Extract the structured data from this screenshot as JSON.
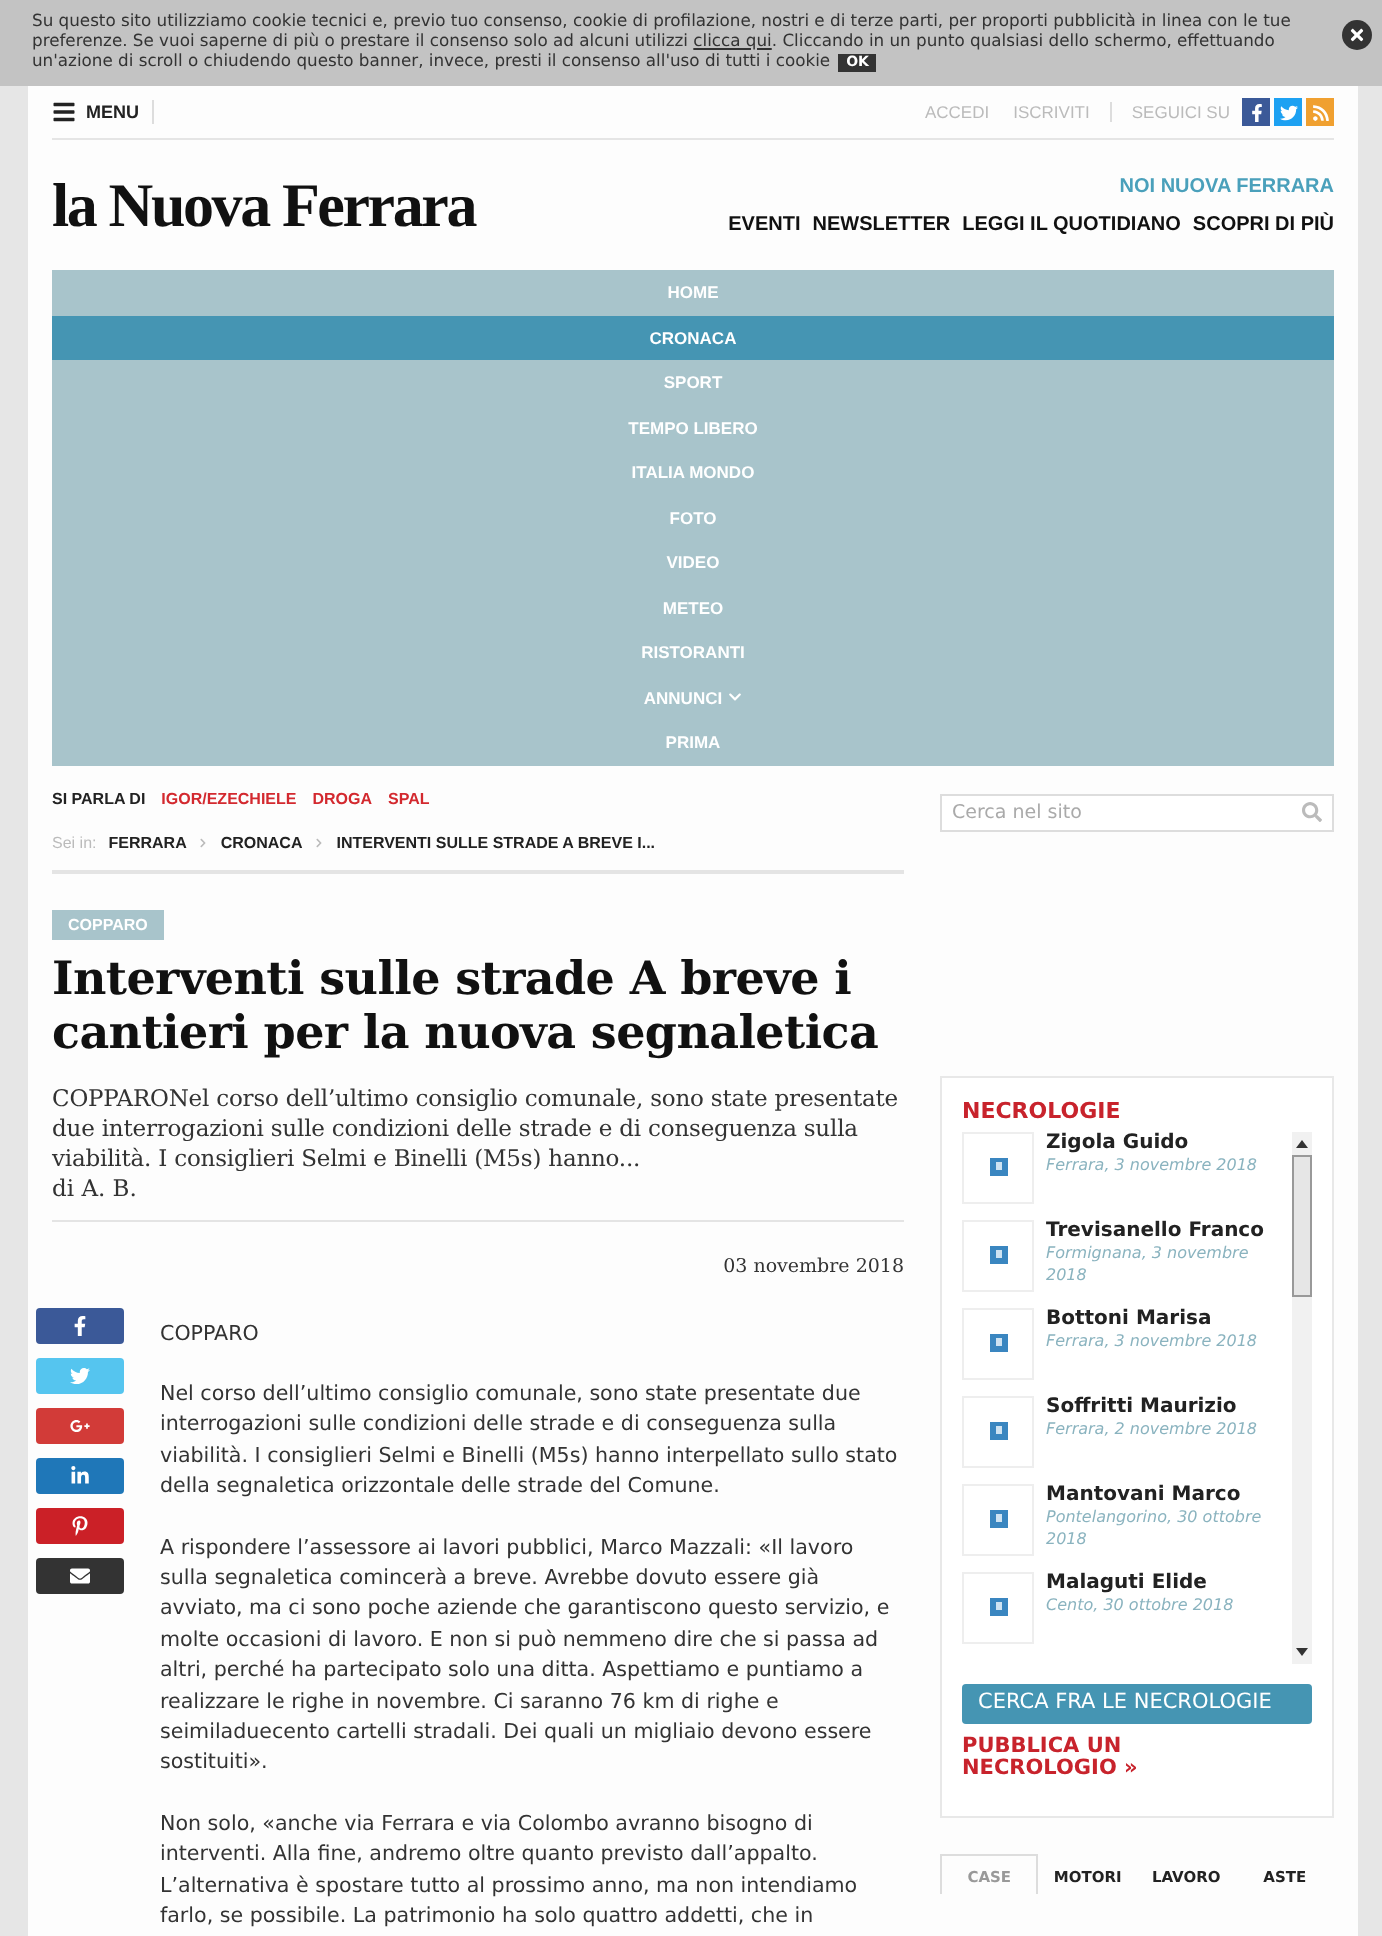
{
  "cookie_banner": {
    "text_before": "Su questo sito utilizziamo cookie tecnici e, previo tuo consenso, cookie di profilazione, nostri e di terze parti, per proporti pubblicità in linea con le tue preferenze. Se vuoi saperne di più o prestare il consenso solo ad alcuni utilizzi ",
    "link": "clicca qui",
    "text_after": ". Cliccando in un punto qualsiasi dello schermo, effettuando un'azione di scroll o chiudendo questo banner, invece, presti il consenso all'uso di tutti i cookie",
    "ok": "OK"
  },
  "header": {
    "menu": "MENU",
    "links": [
      "ACCEDI",
      "ISCRIVITI"
    ],
    "follow": "SEGUICI SU",
    "social": [
      {
        "kind": "facebook",
        "color": "#3b5998"
      },
      {
        "kind": "twitter",
        "color": "#1da1f2"
      },
      {
        "kind": "rss",
        "color": "#f0a030"
      }
    ]
  },
  "masthead": {
    "logo": "la Nuova Ferrara",
    "highlight": "NOI NUOVA FERRARA",
    "links": [
      "EVENTI",
      "NEWSLETTER",
      "LEGGI IL QUOTIDIANO",
      "SCOPRI DI PIÙ"
    ]
  },
  "nav": [
    {
      "label": "HOME",
      "selected": false,
      "dropdown": false
    },
    {
      "label": "CRONACA",
      "selected": true,
      "dropdown": false
    },
    {
      "label": "SPORT",
      "selected": false,
      "dropdown": false
    },
    {
      "label": "TEMPO LIBERO",
      "selected": false,
      "dropdown": false
    },
    {
      "label": "ITALIA MONDO",
      "selected": false,
      "dropdown": false
    },
    {
      "label": "FOTO",
      "selected": false,
      "dropdown": false
    },
    {
      "label": "VIDEO",
      "selected": false,
      "dropdown": false
    },
    {
      "label": "METEO",
      "selected": false,
      "dropdown": false
    },
    {
      "label": "RISTORANTI",
      "selected": false,
      "dropdown": false
    },
    {
      "label": "ANNUNCI",
      "selected": false,
      "dropdown": true
    },
    {
      "label": "PRIMA",
      "selected": false,
      "dropdown": false
    }
  ],
  "topics": {
    "label": "SI PARLA DI",
    "tags": [
      "IGOR/EZECHIELE",
      "DROGA",
      "SPAL"
    ]
  },
  "search": {
    "placeholder": "Cerca nel sito"
  },
  "breadcrumb": {
    "label": "Sei in:",
    "items": [
      "FERRARA",
      "CRONACA",
      "INTERVENTI SULLE STRADE A BREVE I..."
    ]
  },
  "article": {
    "category": "COPPARO",
    "title": "Interventi sulle strade A breve i cantieri per la nuova segnaletica",
    "summary": "COPPARONel corso dell’ultimo consiglio comunale, sono state presentate due interrogazioni sulle condizioni delle strade e di conseguenza sulla viabilità. I consiglieri Selmi e Binelli (M5s) hanno...",
    "byline": "di A. B.",
    "date": "03 novembre 2018",
    "share": [
      {
        "kind": "facebook",
        "color": "#3b5998"
      },
      {
        "kind": "twitter",
        "color": "#55c5ef"
      },
      {
        "kind": "googleplus",
        "color": "#d23b38"
      },
      {
        "kind": "linkedin",
        "color": "#1f77b8"
      },
      {
        "kind": "pinterest",
        "color": "#cb2027"
      },
      {
        "kind": "email",
        "color": "#333333"
      }
    ],
    "body": [
      "COPPARO",
      "Nel corso dell’ultimo consiglio comunale, sono state presentate due interrogazioni sulle condizioni delle strade e di conseguenza sulla viabilità. I consiglieri Selmi e Binelli (M5s) hanno interpellato sullo stato della segnaletica orizzontale delle strade del Comune.",
      "A rispondere l’assessore ai lavori pubblici, Marco Mazzali: «Il lavoro sulla segnaletica comincerà a breve. Avrebbe dovuto essere già avviato, ma ci sono poche aziende che garantiscono questo servizio, e molte occasioni di lavoro. E non si può nemmeno dire che si passa ad altri, perché ha partecipato solo una ditta. Aspettiamo e puntiamo a realizzare le righe in novembre. Ci saranno 76 km di righe e seimiladuecento cartelli stradali. Dei quali un migliaio devono essere sostituiti».",
      "Non solo, «anche via Ferrara e via Colombo avranno bisogno di interventi. Alla fine, andremo oltre quanto previsto dall’appalto. L’alternativa è spostare tutto al prossimo anno, ma non intendiamo farlo, se possibile. La patrimonio ha solo quattro addetti, che in"
    ]
  },
  "obituaries": {
    "title": "NECROLOGIE",
    "items": [
      {
        "name": "Zigola Guido",
        "place_date": "Ferrara, 3 novembre 2018"
      },
      {
        "name": "Trevisanello Franco",
        "place_date": "Formignana, 3 novembre 2018"
      },
      {
        "name": "Bottoni Marisa",
        "place_date": "Ferrara, 3 novembre 2018"
      },
      {
        "name": "Soffritti Maurizio",
        "place_date": "Ferrara, 2 novembre 2018"
      },
      {
        "name": "Mantovani Marco",
        "place_date": "Pontelangorino, 30 ottobre 2018"
      },
      {
        "name": "Malaguti Elide",
        "place_date": "Cento, 30 ottobre 2018"
      }
    ],
    "search_button": "CERCA FRA LE NECROLOGIE",
    "publish_link": "PUBBLICA UN NECROLOGIO »"
  },
  "classifieds_tabs": [
    {
      "label": "CASE",
      "selected": true
    },
    {
      "label": "MOTORI",
      "selected": false
    },
    {
      "label": "LAVORO",
      "selected": false
    },
    {
      "label": "ASTE",
      "selected": false
    }
  ]
}
